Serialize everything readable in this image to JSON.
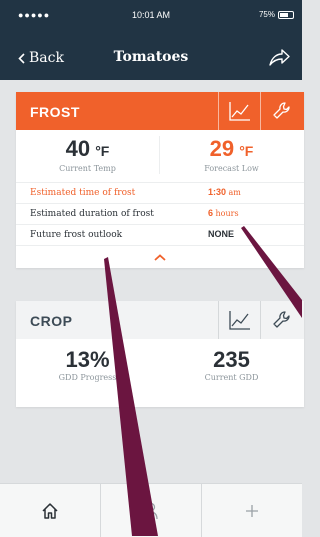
{
  "status": {
    "signal": "●●●●● ",
    "time": "10:01 AM",
    "battery": "75%"
  },
  "nav": {
    "back_label": "Back",
    "title": "Tomatoes"
  },
  "frost": {
    "name": "FROST",
    "current_temp": {
      "value": "40",
      "unit": "°F",
      "label": "Current Temp"
    },
    "forecast_low": {
      "value": "29",
      "unit": "°F",
      "label": "Forecast Low"
    },
    "rows": [
      {
        "label": "Estimated time of frost",
        "value": "1:30",
        "suffix": "am"
      },
      {
        "label": "Estimated duration of frost",
        "value": "6",
        "suffix": "hours"
      },
      {
        "label": "Future frost outlook",
        "value": "NONE",
        "suffix": ""
      }
    ]
  },
  "crop": {
    "name": "CROP",
    "gdd_progress": {
      "value": "13%",
      "label": "GDD Progress"
    },
    "current_gdd": {
      "value": "235",
      "label": "Current GDD"
    }
  },
  "colors": {
    "header": "#213444",
    "accent": "#f0612b",
    "pointer": "#6b1540"
  },
  "icons": {
    "back": "chevron-left-icon",
    "share": "share-arrow-icon",
    "chart": "line-chart-icon",
    "settings": "wrench-icon",
    "expand": "chevron-up-icon",
    "tabs": [
      "home-icon",
      "person-icon",
      "plus-icon"
    ]
  }
}
